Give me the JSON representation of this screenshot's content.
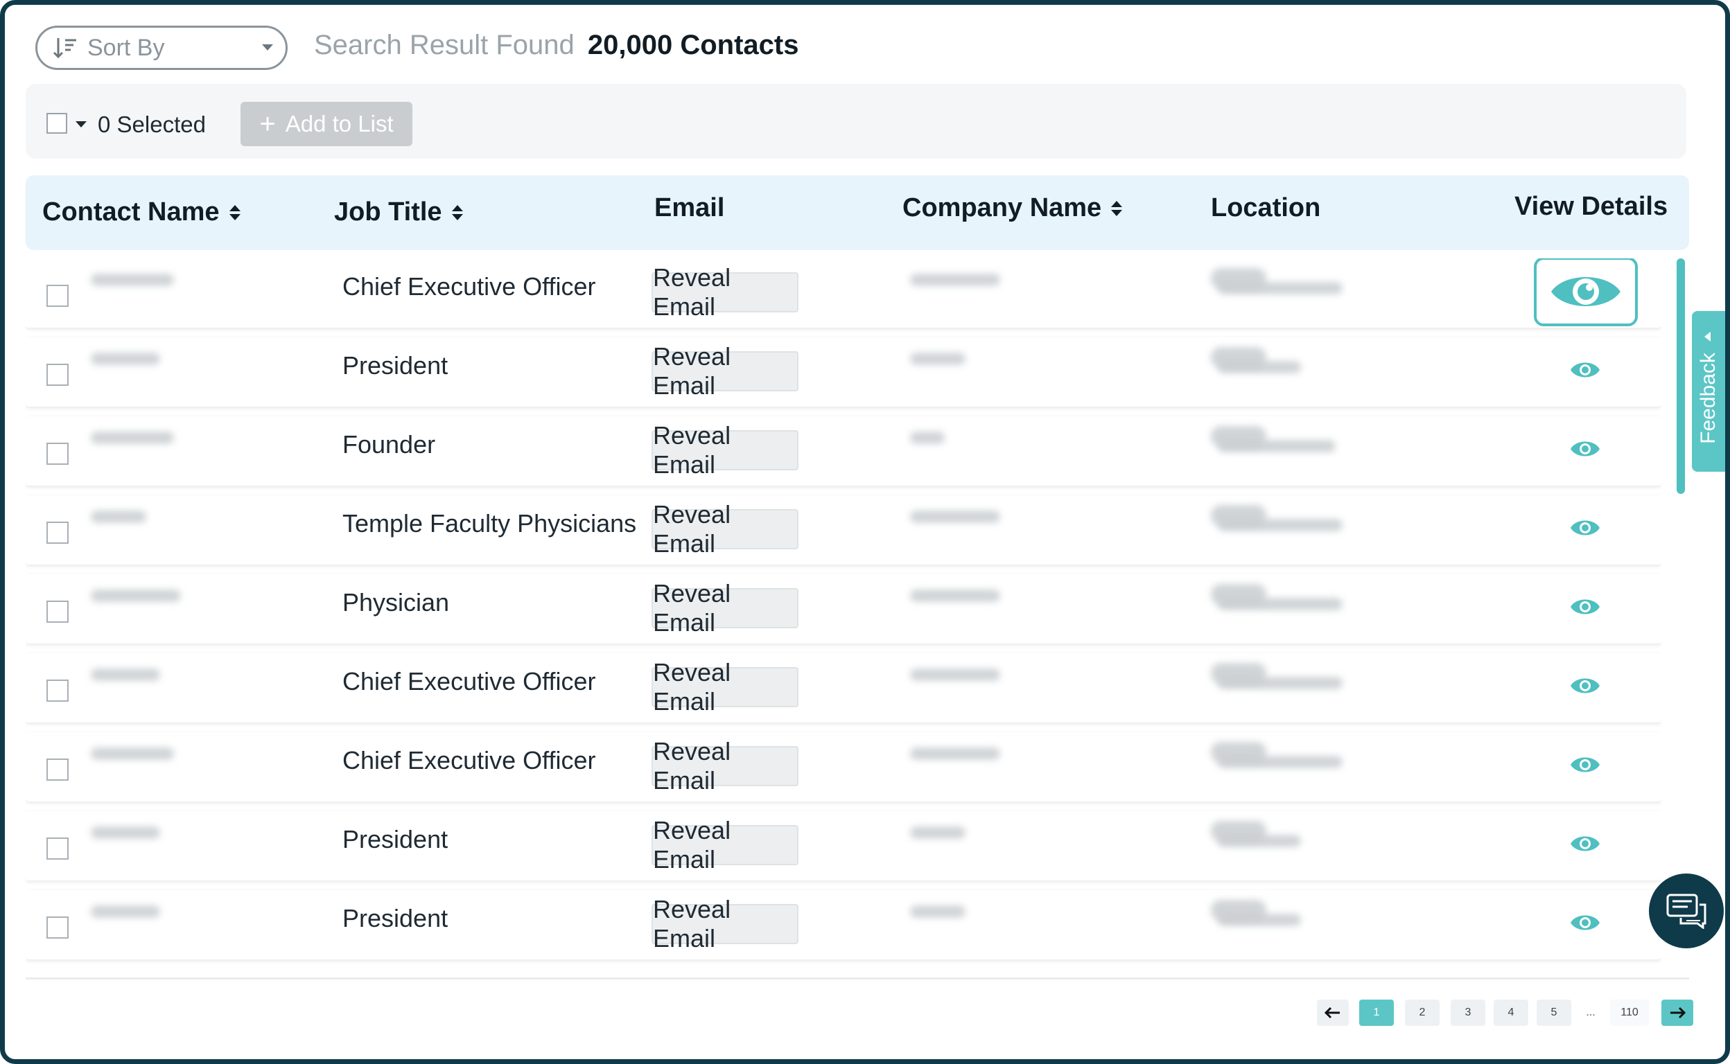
{
  "toolbar": {
    "sort_by_label": "Sort By",
    "result_prefix": "Search Result Found",
    "result_count": "20,000 Contacts"
  },
  "action_bar": {
    "selected_label": "0 Selected",
    "add_to_list_label": "Add to List"
  },
  "table": {
    "headers": {
      "contact_name": "Contact Name",
      "job_title": "Job Title",
      "email": "Email",
      "company_name": "Company Name",
      "location": "Location",
      "view_details": "View Details"
    },
    "rows": [
      {
        "job_title": "Chief Executive Officer",
        "email_action": "Reveal Email"
      },
      {
        "job_title": "President",
        "email_action": "Reveal Email"
      },
      {
        "job_title": "Founder",
        "email_action": "Reveal Email"
      },
      {
        "job_title": "Temple Faculty Physicians",
        "email_action": "Reveal Email"
      },
      {
        "job_title": "Physician",
        "email_action": "Reveal Email"
      },
      {
        "job_title": "Chief Executive Officer",
        "email_action": "Reveal Email"
      },
      {
        "job_title": "Chief Executive Officer",
        "email_action": "Reveal Email"
      },
      {
        "job_title": "President",
        "email_action": "Reveal Email"
      },
      {
        "job_title": "President",
        "email_action": "Reveal Email"
      }
    ]
  },
  "feedback": {
    "label": "Feedback"
  },
  "pagination": {
    "pages": [
      "1",
      "2",
      "3",
      "4",
      "5"
    ],
    "ellipsis": "...",
    "last_page": "110",
    "current": "1"
  },
  "colors": {
    "accent": "#4fbfc0",
    "header_bg": "#e8f4fb",
    "frame": "#0f3a4a"
  },
  "icons": {
    "sort": "sort-lines-icon",
    "eye": "eye-icon",
    "chat": "chat-icon",
    "prev": "arrow-left-icon",
    "next": "arrow-right-icon"
  }
}
